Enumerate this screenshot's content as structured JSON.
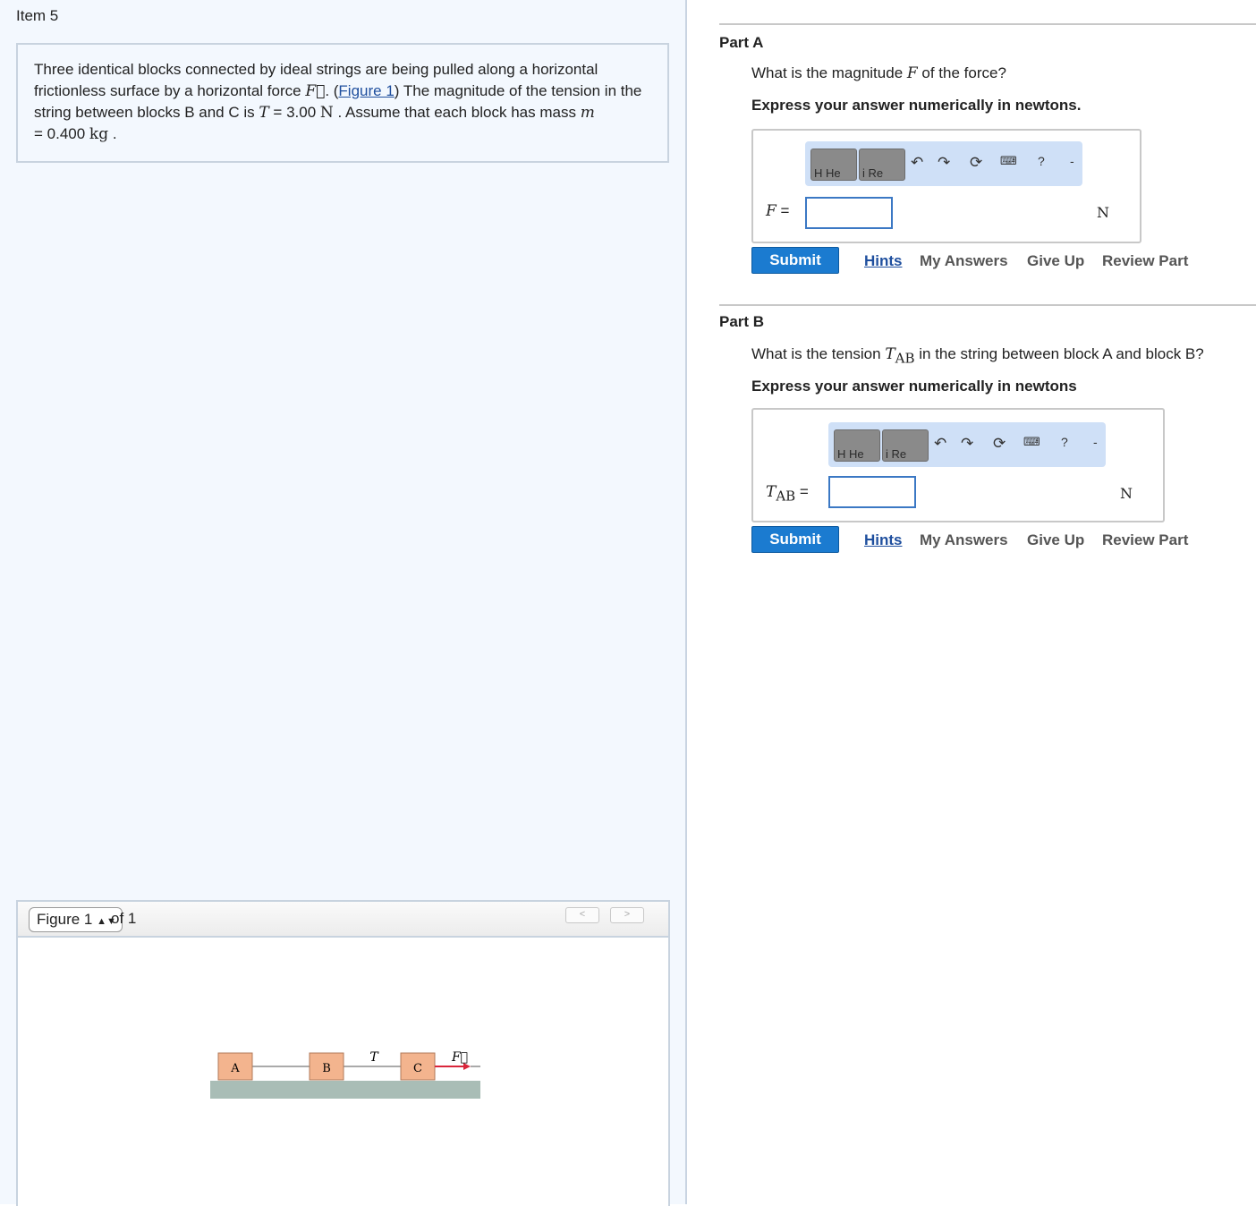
{
  "item_title": "Item 5",
  "problem": {
    "t1": "Three identical blocks connected by ideal strings are being pulled along a horizontal frictionless surface by a horizontal force ",
    "force_symbol": "F⃗",
    "t2": ". (",
    "figure_link": "Figure 1",
    "t3": ") The magnitude of the tension in the string between blocks B and C is ",
    "tension_symbol": "T",
    "tension_eq": " = 3.00 ",
    "tension_unit": "N",
    "t4": " . Assume that each block has mass ",
    "mass_symbol": "m",
    "mass_eq": " = 0.400 ",
    "mass_unit": "kg",
    "t5": " ."
  },
  "figure": {
    "select_label": "Figure 1",
    "of_text": "of 1",
    "prev_label": "<",
    "next_label": ">",
    "block_a": "A",
    "block_b": "B",
    "block_c": "C",
    "tension_label": "T",
    "force_label": "F⃗",
    "colors": {
      "block": "#f3b48e",
      "ground": "#a9bdb6",
      "force_arrow": "#d9263b"
    }
  },
  "toolbar": {
    "btn1": "H He",
    "btn2": "i Re",
    "undo_icon": "undo-icon",
    "redo_icon": "redo-icon",
    "reset_icon": "reset-icon",
    "keyboard_icon": "keyboard-icon",
    "help_icon": "help-icon",
    "help_text": "?",
    "dash": "-"
  },
  "part_a": {
    "label": "Part A",
    "q1": "What is the magnitude ",
    "q_sym": "F",
    "q2": " of the force?",
    "instruction": "Express your answer numerically in newtons.",
    "eq_sym": "F",
    "eq_sign": " =",
    "input_value": "",
    "unit": "N"
  },
  "part_b": {
    "label": "Part B",
    "q1": "What is the tension ",
    "q_sym": "T",
    "q_sub": "AB",
    "q2": " in the string between block A and block B?",
    "instruction": "Express your answer numerically in newtons",
    "eq_sym": "T",
    "eq_sub": "AB",
    "eq_sign": " =",
    "input_value": "",
    "unit": "N"
  },
  "actions": {
    "submit": "Submit",
    "hints": "Hints",
    "my_answers": "My Answers",
    "give_up": "Give Up",
    "review_part": "Review Part"
  }
}
